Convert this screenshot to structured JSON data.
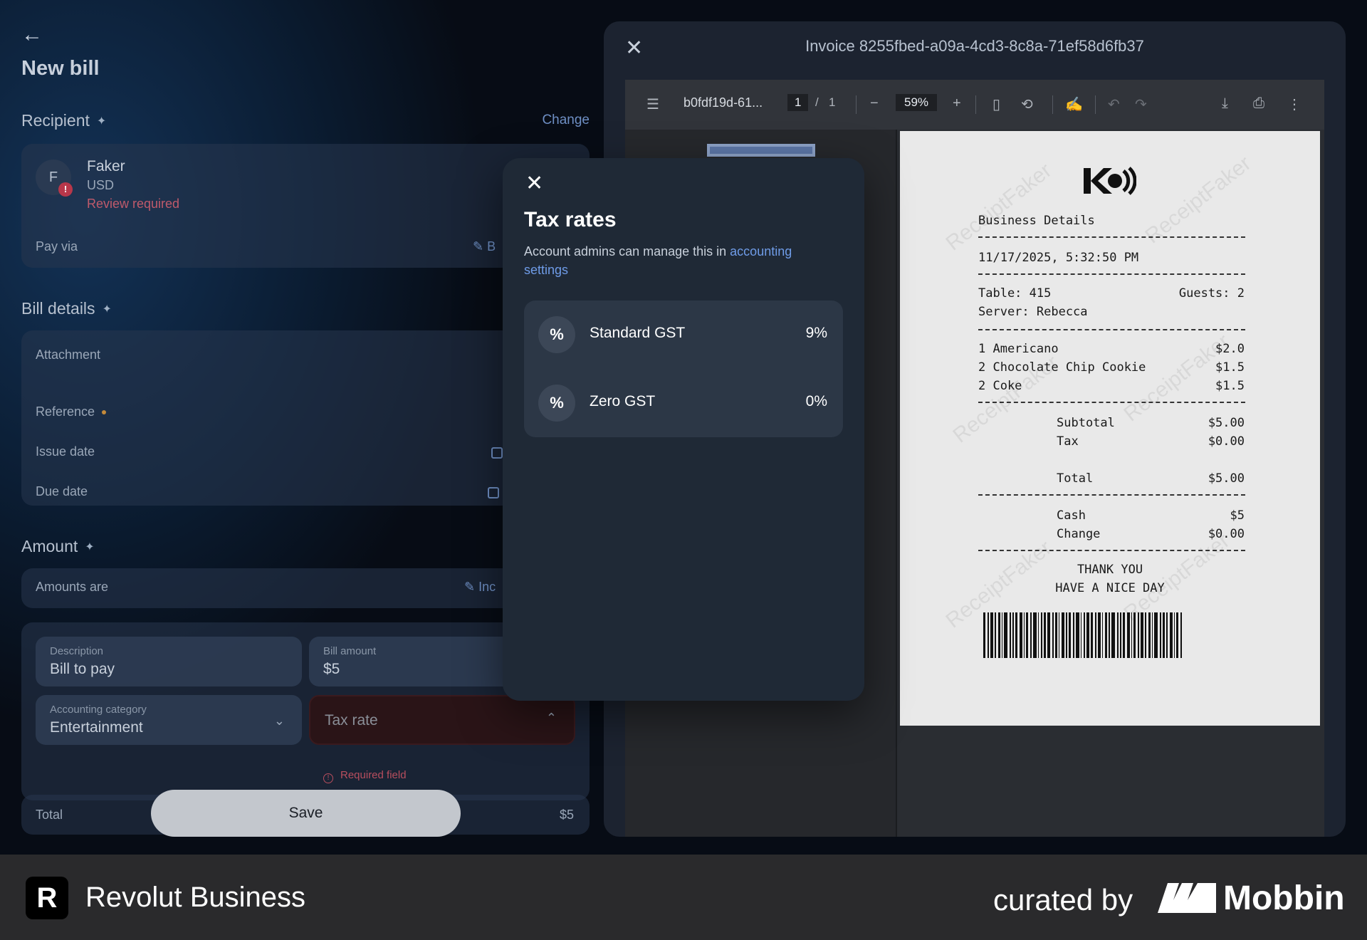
{
  "page": {
    "title": "New bill"
  },
  "recipient": {
    "section_title": "Recipient",
    "change_label": "Change",
    "avatar_initial": "F",
    "avatar_alert": "!",
    "name": "Faker",
    "currency": "USD",
    "status": "Review required",
    "pay_via_label": "Pay via",
    "pay_via_value": "B"
  },
  "bill_details": {
    "section_title": "Bill details",
    "attachment_label": "Attachment",
    "reference_label": "Reference",
    "issue_date_label": "Issue date",
    "due_date_label": "Due date"
  },
  "amount": {
    "section_title": "Amount",
    "amounts_are_label": "Amounts are",
    "amounts_are_value": "Inc",
    "description_label": "Description",
    "description_value": "Bill to pay",
    "bill_amount_label": "Bill amount",
    "bill_amount_value": "$5",
    "category_label": "Accounting category",
    "category_value": "Entertainment",
    "tax_rate_placeholder": "Tax rate",
    "required_text": "Required field",
    "total_label": "Total",
    "total_value": "$5",
    "save_label": "Save"
  },
  "invoice": {
    "title": "Invoice 8255fbed-a09a-4cd3-8c8a-71ef58d6fb37",
    "file_name": "b0fdf19d-61...",
    "page_current": "1",
    "page_sep": "/",
    "page_total": "1",
    "zoom": "59%",
    "receipt": {
      "header": "Business Details",
      "datetime": "11/17/2025, 5:32:50 PM",
      "table": "Table: 415",
      "guests": "Guests: 2",
      "server": "Server: Rebecca",
      "items": [
        {
          "name": "1 Americano",
          "price": "$2.0"
        },
        {
          "name": "2 Chocolate Chip Cookie",
          "price": "$1.5"
        },
        {
          "name": "2 Coke",
          "price": "$1.5"
        }
      ],
      "subtotal_label": "Subtotal",
      "subtotal": "$5.00",
      "tax_label": "Tax",
      "tax": "$0.00",
      "total_label": "Total",
      "total": "$5.00",
      "cash_label": "Cash",
      "cash": "$5",
      "change_label": "Change",
      "change": "$0.00",
      "thanks1": "THANK YOU",
      "thanks2": "HAVE A NICE DAY",
      "watermark": "ReceiptFaker"
    }
  },
  "tax_modal": {
    "title": "Tax rates",
    "subtitle_prefix": "Account admins can manage this in ",
    "subtitle_link": "accounting settings",
    "rates": [
      {
        "icon": "%",
        "name": "Standard GST",
        "value": "9%"
      },
      {
        "icon": "%",
        "name": "Zero GST",
        "value": "0%"
      }
    ]
  },
  "footer": {
    "brand": "Revolut Business",
    "logo_letter": "R",
    "curated": "curated by",
    "mobbin": "Mobbin"
  }
}
